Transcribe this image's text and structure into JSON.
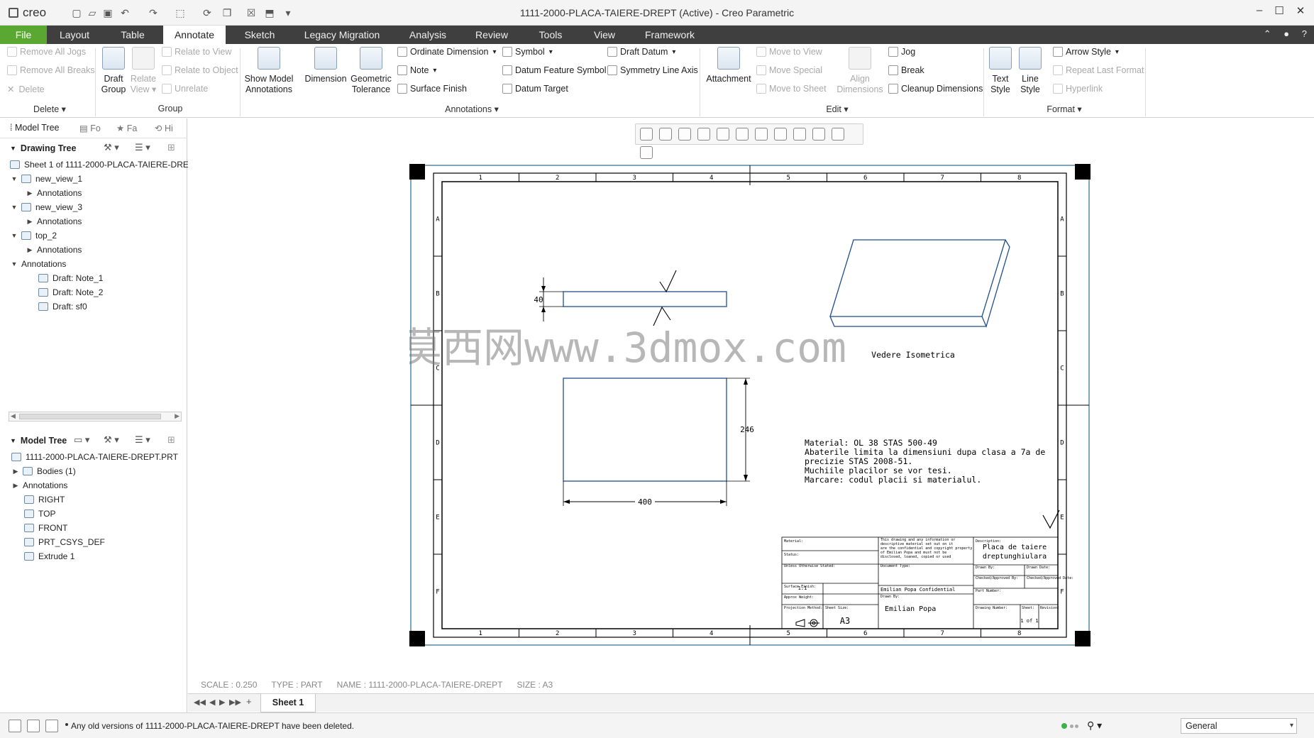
{
  "app": {
    "title": "1111-2000-PLACA-TAIERE-DREPT (Active) - Creo Parametric",
    "logo": "creo"
  },
  "tabs": [
    "File",
    "Layout",
    "Table",
    "Annotate",
    "Sketch",
    "Legacy Migration",
    "Analysis",
    "Review",
    "Tools",
    "View",
    "Framework"
  ],
  "active_tab": "Annotate",
  "ribbon": {
    "delete_group": {
      "remove_jogs": "Remove All Jogs",
      "remove_breaks": "Remove All Breaks",
      "delete": "Delete",
      "label": "Delete ▾"
    },
    "group_group": {
      "draft_group": "Draft\nGroup",
      "draft_group_l1": "Draft",
      "draft_group_l2": "Group",
      "relate_view_l1": "Relate",
      "relate_view_l2": "View ▾",
      "relate_to_view": "Relate to View",
      "relate_to_object": "Relate to Object",
      "unrelate": "Unrelate",
      "label": "Group"
    },
    "annotations_group": {
      "show_model_l1": "Show Model",
      "show_model_l2": "Annotations",
      "dimension": "Dimension",
      "geom_tol_l1": "Geometric",
      "geom_tol_l2": "Tolerance",
      "ordinate_dimension": "Ordinate Dimension",
      "note": "Note",
      "surface_finish": "Surface Finish",
      "symbol": "Symbol",
      "datum_feature_symbol": "Datum Feature Symbol",
      "datum_target": "Datum Target",
      "draft_datum": "Draft Datum",
      "symmetry_line_axis": "Symmetry Line Axis",
      "label": "Annotations ▾"
    },
    "edit_group": {
      "attachment": "Attachment",
      "move_to_view": "Move to View",
      "move_special": "Move Special",
      "move_to_sheet": "Move to Sheet",
      "align_l1": "Align",
      "align_l2": "Dimensions",
      "jog": "Jog",
      "break": "Break",
      "cleanup_dimensions": "Cleanup Dimensions",
      "label": "Edit ▾"
    },
    "format_group": {
      "text_style_l1": "Text",
      "text_style_l2": "Style",
      "line_style_l1": "Line",
      "line_style_l2": "Style",
      "arrow_style": "Arrow Style",
      "repeat_last_format": "Repeat Last Format",
      "hyperlink": "Hyperlink",
      "label": "Format ▾"
    }
  },
  "left_panel": {
    "tabs": [
      "Model Tree",
      "Fo",
      "Fa",
      "Hi"
    ],
    "drawing_tree_header": "Drawing Tree",
    "drawing_tree": [
      {
        "label": "Sheet 1 of 1111-2000-PLACA-TAIERE-DREPT"
      },
      {
        "label": "new_view_1"
      },
      {
        "label": "Annotations"
      },
      {
        "label": "new_view_3"
      },
      {
        "label": "Annotations"
      },
      {
        "label": "top_2"
      },
      {
        "label": "Annotations"
      },
      {
        "label": "Annotations"
      },
      {
        "label": "Draft: Note_1"
      },
      {
        "label": "Draft: Note_2"
      },
      {
        "label": "Draft: sf0"
      }
    ],
    "model_tree_header": "Model Tree",
    "model_tree": [
      {
        "label": "1111-2000-PLACA-TAIERE-DREPT.PRT"
      },
      {
        "label": "Bodies (1)"
      },
      {
        "label": "Annotations"
      },
      {
        "label": "RIGHT"
      },
      {
        "label": "TOP"
      },
      {
        "label": "FRONT"
      },
      {
        "label": "PRT_CSYS_DEF"
      },
      {
        "label": "Extrude 1"
      }
    ]
  },
  "drawing": {
    "col_labels": [
      "1",
      "2",
      "3",
      "4",
      "5",
      "6",
      "7",
      "8"
    ],
    "row_labels": [
      "A",
      "B",
      "C",
      "D",
      "E",
      "F"
    ],
    "dim_thickness": "40",
    "dim_height": "246",
    "dim_width": "400",
    "iso_label": "Vedere Isometrica",
    "notes": [
      "Material: OL 38 STAS 500-49",
      "Abaterile limita la dimensiuni dupa clasa a 7a de",
      "precizie STAS 2008-51.",
      "Muchiile placilor se vor tesi.",
      "Marcare: codul placii si materialul."
    ],
    "title_block": {
      "description_label": "Description:",
      "description_l1": "Placa de taiere",
      "description_l2": "dreptunghiulara",
      "author_name": "Emilian Popa",
      "confidential": "Emilian Popa Confidential",
      "size": "A3",
      "scale": "1:1",
      "sheet": "1 of 1"
    },
    "watermark": "莫西网www.3dmox.com"
  },
  "sheet_info": {
    "scale": "SCALE : 0.250",
    "type": "TYPE : PART",
    "name": "NAME : 1111-2000-PLACA-TAIERE-DREPT",
    "size": "SIZE : A3"
  },
  "sheet_tab": "Sheet 1",
  "status": {
    "message": "Any old versions of 1111-2000-PLACA-TAIERE-DREPT have been deleted.",
    "filter": "General"
  },
  "colors": {
    "file_tab": "#5aa832",
    "tab_bar": "#3f3f3f",
    "geometry": "#1f4e8c",
    "frame": "#000000"
  }
}
